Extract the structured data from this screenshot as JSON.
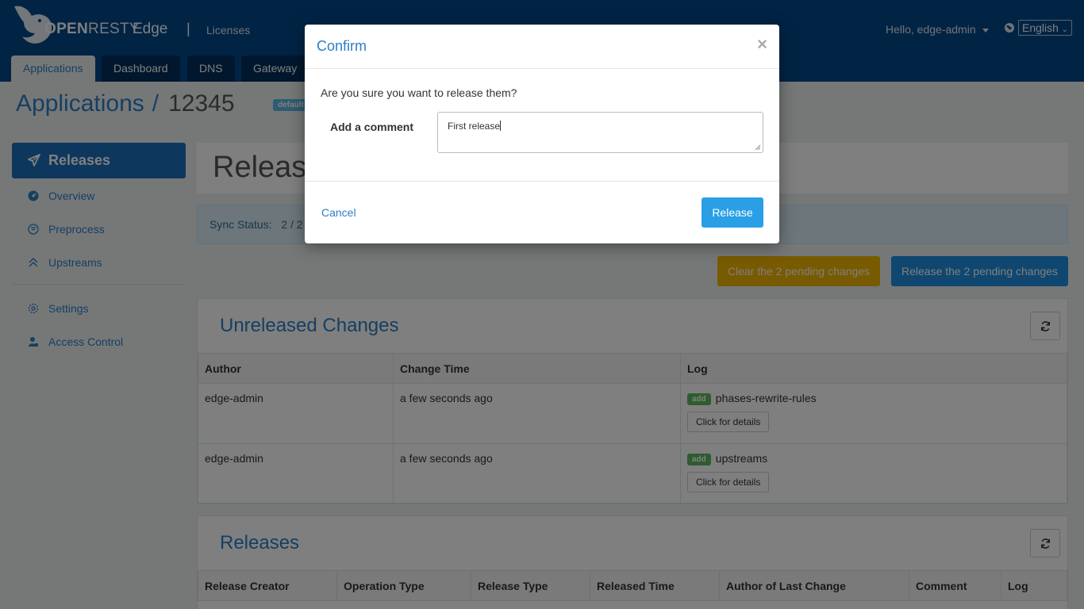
{
  "header": {
    "brand_bold": "OPEN",
    "brand_light": "RESTY",
    "brand_product": "Edge",
    "brand_separator": "|",
    "nav_licenses": "Licenses",
    "user_greeting": "Hello, edge-admin",
    "language": "English"
  },
  "tabs": [
    "Applications",
    "Dashboard",
    "DNS",
    "Gateway G"
  ],
  "page": {
    "section": "Applications",
    "separator": "/",
    "app_id": "12345",
    "badge": "default"
  },
  "sidebar": {
    "active": "Releases",
    "items": [
      "Overview",
      "Preprocess",
      "Upstreams"
    ],
    "items_lower": [
      "Settings",
      "Access Control"
    ]
  },
  "main": {
    "heading": "Releases",
    "sync_label": "Sync Status:",
    "sync_value": "2 / 2",
    "clear_button": "Clear the 2 pending changes",
    "release_button": "Release the 2 pending changes"
  },
  "unreleased": {
    "title": "Unreleased Changes",
    "columns": [
      "Author",
      "Change Time",
      "Log"
    ],
    "rows": [
      {
        "author": "edge-admin",
        "time": "a few seconds ago",
        "badge": "add",
        "log": "phases-rewrite-rules",
        "details": "Click for details"
      },
      {
        "author": "edge-admin",
        "time": "a few seconds ago",
        "badge": "add",
        "log": "upstreams",
        "details": "Click for details"
      }
    ]
  },
  "releases": {
    "title": "Releases",
    "columns": [
      "Release Creator",
      "Operation Type",
      "Release Type",
      "Released Time",
      "Author of Last Change",
      "Comment",
      "Log"
    ]
  },
  "modal": {
    "title": "Confirm",
    "close": "×",
    "question": "Are you sure you want to release them?",
    "comment_label": "Add a comment",
    "comment_value": "First release",
    "cancel": "Cancel",
    "release": "Release"
  },
  "colors": {
    "header_bg": "#03488a",
    "accent": "#2c7ec4",
    "primary_button": "#1f8fe0",
    "warning_button": "#f0b400",
    "add_badge": "#5cb85c"
  }
}
